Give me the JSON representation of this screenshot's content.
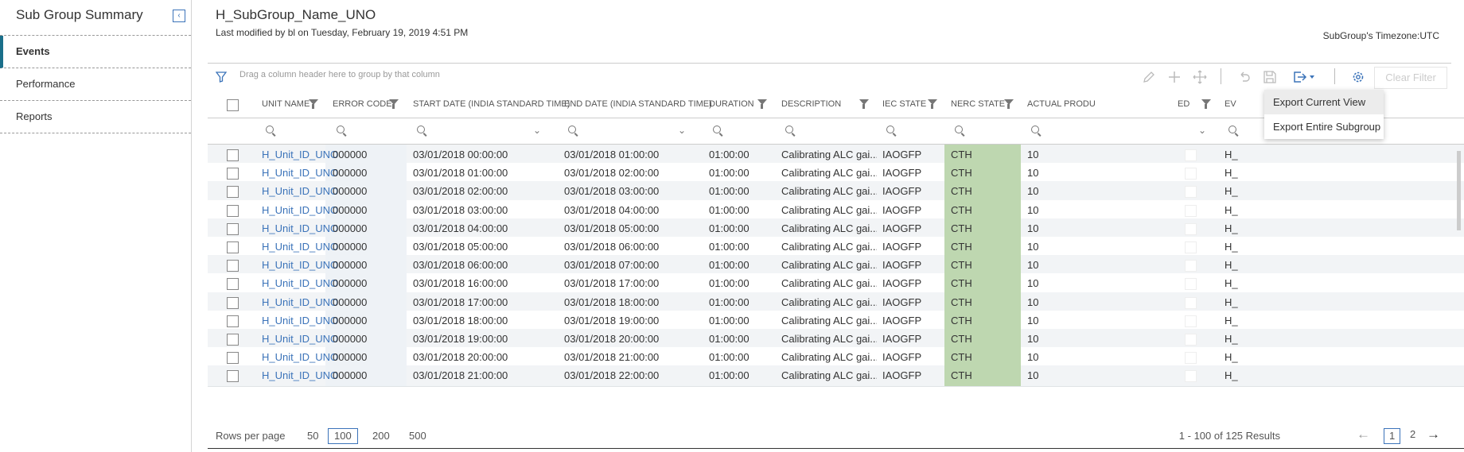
{
  "sidebar": {
    "title": "Sub Group Summary",
    "items": [
      {
        "label": "Events",
        "active": true
      },
      {
        "label": "Performance",
        "active": false
      },
      {
        "label": "Reports",
        "active": false
      }
    ]
  },
  "header": {
    "title": "H_SubGroup_Name_UNO",
    "subtitle": "Last modified by bl on Tuesday, February 19, 2019 4:51 PM",
    "timezone": "SubGroup's Timezone:UTC"
  },
  "toolbar": {
    "group_hint": "Drag a column header here to group by that column",
    "clear_filter": "Clear Filter"
  },
  "export_menu": {
    "items": [
      "Export Current View",
      "Export Entire Subgroup"
    ]
  },
  "columns": [
    "UNIT NAME",
    "ERROR CODE",
    "START DATE (INDIA STANDARD TIME)",
    "END DATE (INDIA STANDARD TIME)",
    "DURATION",
    "DESCRIPTION",
    "IEC STATE",
    "NERC STATE",
    "ACTUAL PRODU",
    "ED",
    "EV"
  ],
  "rows": [
    {
      "unit": "H_Unit_ID_UNO",
      "code": "000000",
      "start": "03/01/2018 00:00:00",
      "end": "03/01/2018 01:00:00",
      "duration": "01:00:00",
      "desc": "Calibrating ALC gai...",
      "iec": "IAOGFP",
      "nerc": "CTH",
      "actual": "10",
      "ev": "H_"
    },
    {
      "unit": "H_Unit_ID_UNO",
      "code": "000000",
      "start": "03/01/2018 01:00:00",
      "end": "03/01/2018 02:00:00",
      "duration": "01:00:00",
      "desc": "Calibrating ALC gai...",
      "iec": "IAOGFP",
      "nerc": "CTH",
      "actual": "10",
      "ev": "H_"
    },
    {
      "unit": "H_Unit_ID_UNO",
      "code": "000000",
      "start": "03/01/2018 02:00:00",
      "end": "03/01/2018 03:00:00",
      "duration": "01:00:00",
      "desc": "Calibrating ALC gai...",
      "iec": "IAOGFP",
      "nerc": "CTH",
      "actual": "10",
      "ev": "H_"
    },
    {
      "unit": "H_Unit_ID_UNO",
      "code": "000000",
      "start": "03/01/2018 03:00:00",
      "end": "03/01/2018 04:00:00",
      "duration": "01:00:00",
      "desc": "Calibrating ALC gai...",
      "iec": "IAOGFP",
      "nerc": "CTH",
      "actual": "10",
      "ev": "H_"
    },
    {
      "unit": "H_Unit_ID_UNO",
      "code": "000000",
      "start": "03/01/2018 04:00:00",
      "end": "03/01/2018 05:00:00",
      "duration": "01:00:00",
      "desc": "Calibrating ALC gai...",
      "iec": "IAOGFP",
      "nerc": "CTH",
      "actual": "10",
      "ev": "H_"
    },
    {
      "unit": "H_Unit_ID_UNO",
      "code": "000000",
      "start": "03/01/2018 05:00:00",
      "end": "03/01/2018 06:00:00",
      "duration": "01:00:00",
      "desc": "Calibrating ALC gai...",
      "iec": "IAOGFP",
      "nerc": "CTH",
      "actual": "10",
      "ev": "H_"
    },
    {
      "unit": "H_Unit_ID_UNO",
      "code": "000000",
      "start": "03/01/2018 06:00:00",
      "end": "03/01/2018 07:00:00",
      "duration": "01:00:00",
      "desc": "Calibrating ALC gai...",
      "iec": "IAOGFP",
      "nerc": "CTH",
      "actual": "10",
      "ev": "H_"
    },
    {
      "unit": "H_Unit_ID_UNO",
      "code": "000000",
      "start": "03/01/2018 16:00:00",
      "end": "03/01/2018 17:00:00",
      "duration": "01:00:00",
      "desc": "Calibrating ALC gai...",
      "iec": "IAOGFP",
      "nerc": "CTH",
      "actual": "10",
      "ev": "H_"
    },
    {
      "unit": "H_Unit_ID_UNO",
      "code": "000000",
      "start": "03/01/2018 17:00:00",
      "end": "03/01/2018 18:00:00",
      "duration": "01:00:00",
      "desc": "Calibrating ALC gai...",
      "iec": "IAOGFP",
      "nerc": "CTH",
      "actual": "10",
      "ev": "H_"
    },
    {
      "unit": "H_Unit_ID_UNO",
      "code": "000000",
      "start": "03/01/2018 18:00:00",
      "end": "03/01/2018 19:00:00",
      "duration": "01:00:00",
      "desc": "Calibrating ALC gai...",
      "iec": "IAOGFP",
      "nerc": "CTH",
      "actual": "10",
      "ev": "H_"
    },
    {
      "unit": "H_Unit_ID_UNO",
      "code": "000000",
      "start": "03/01/2018 19:00:00",
      "end": "03/01/2018 20:00:00",
      "duration": "01:00:00",
      "desc": "Calibrating ALC gai...",
      "iec": "IAOGFP",
      "nerc": "CTH",
      "actual": "10",
      "ev": "H_"
    },
    {
      "unit": "H_Unit_ID_UNO",
      "code": "000000",
      "start": "03/01/2018 20:00:00",
      "end": "03/01/2018 21:00:00",
      "duration": "01:00:00",
      "desc": "Calibrating ALC gai...",
      "iec": "IAOGFP",
      "nerc": "CTH",
      "actual": "10",
      "ev": "H_"
    },
    {
      "unit": "H_Unit_ID_UNO",
      "code": "000000",
      "start": "03/01/2018 21:00:00",
      "end": "03/01/2018 22:00:00",
      "duration": "01:00:00",
      "desc": "Calibrating ALC gai...",
      "iec": "IAOGFP",
      "nerc": "CTH",
      "actual": "10",
      "ev": "H_"
    }
  ],
  "footer": {
    "rows_per_page_label": "Rows per page",
    "page_sizes": [
      "50",
      "100",
      "200",
      "500"
    ],
    "selected_page_size": "100",
    "results": "1 - 100 of 125 Results",
    "pages": [
      "1",
      "2"
    ],
    "current_page": "1"
  },
  "colors": {
    "accent": "#3b73b9",
    "nerc_bg": "#bed7b0",
    "sidebar_active": "#1a6f8a"
  }
}
